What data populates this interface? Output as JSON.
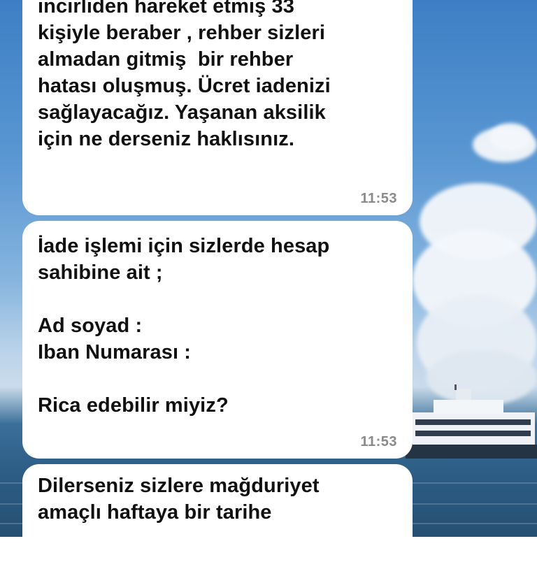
{
  "chat": {
    "messages": [
      {
        "text": "incirliden hareket etmiş 33\nkişiyle beraber , rehber sizleri\nalmadan gitmiş  bir rehber\nhatası oluşmuş. Ücret iadenizi\nsağlayacağız. Yaşanan aksilik\niçin ne derseniz haklısınız.",
        "time": "11:53"
      },
      {
        "text": "İade işlemi için sizlerde hesap\nsahibine ait ;\n\nAd soyad :\nIban Numarası :\n\nRica edebilir miyiz?",
        "time": "11:53"
      },
      {
        "text": "Dilerseniz sizlere mağduriyet\namaçlı haftaya bir tarihe",
        "time": ""
      }
    ]
  },
  "colors": {
    "bubble": "#ffffff",
    "text": "#111111",
    "timestamp": "#8a8a8a",
    "sky": "#5a97d3",
    "sea": "#2c5d85"
  }
}
